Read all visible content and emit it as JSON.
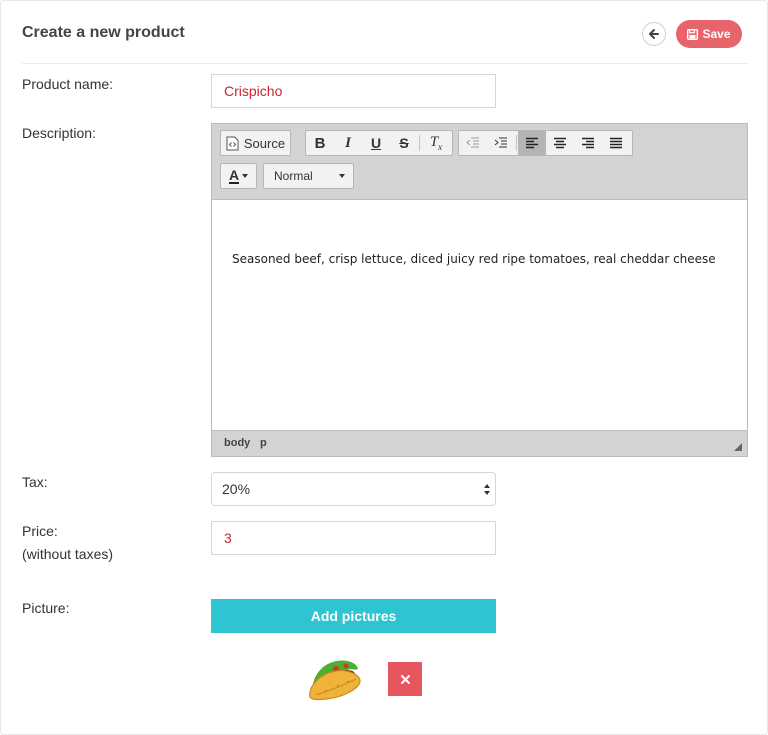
{
  "header": {
    "title": "Create a new product",
    "save_label": "Save"
  },
  "form": {
    "product_name_label": "Product name:",
    "product_name_value": "Crispicho",
    "description_label": "Description:",
    "tax_label": "Tax:",
    "tax_value": "20%",
    "price_label": "Price:",
    "price_sublabel": "(without taxes)",
    "price_value": "3",
    "picture_label": "Picture:",
    "add_pictures_label": "Add pictures"
  },
  "editor": {
    "source_label": "Source",
    "format_value": "Normal",
    "content": "Seasoned beef, crisp lettuce, diced juicy red ripe tomatoes, real cheddar cheese",
    "path": [
      "body",
      "p"
    ],
    "active_alignment": "align-left"
  },
  "colors": {
    "save_button": "#e8646b",
    "add_pictures_button": "#2ec4d1",
    "remove_button": "#e5565f",
    "input_text": "#c3262e"
  },
  "icons": {
    "back": "arrow-left-icon",
    "save": "floppy-disk-icon",
    "remove": "times-icon",
    "picture": "taco-emoji"
  }
}
